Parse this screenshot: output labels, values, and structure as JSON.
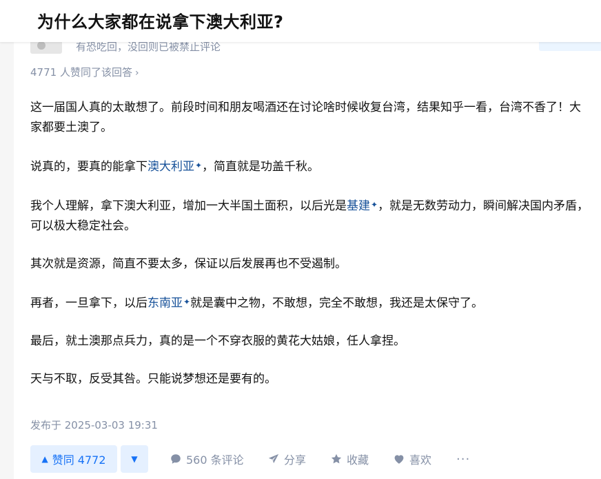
{
  "question": {
    "title": "为什么大家都在说拿下澳大利亚?"
  },
  "author": {
    "notice": "有恐吃回，没回则已被禁止评论"
  },
  "answer": {
    "vote_summary": "4771 人赞同了该回答",
    "paragraphs": [
      {
        "segments": [
          {
            "text": "这一届国人真的太敢想了。前段时间和朋友喝酒还在讨论啥时候收复台湾，结果知乎一看，台湾不香了！大家都要土澳了。"
          }
        ]
      },
      {
        "segments": [
          {
            "text": "说真的，要真的能拿下"
          },
          {
            "text": "澳大利亚",
            "link": true
          },
          {
            "text": "，简直就是功盖千秋。"
          }
        ]
      },
      {
        "segments": [
          {
            "text": "我个人理解，拿下澳大利亚，增加一大半国土面积，以后光是"
          },
          {
            "text": "基建",
            "link": true
          },
          {
            "text": "，就是无数劳动力，瞬间解决国内矛盾，可以极大稳定社会。"
          }
        ]
      },
      {
        "segments": [
          {
            "text": "其次就是资源，简直不要太多，保证以后发展再也不受遏制。"
          }
        ]
      },
      {
        "segments": [
          {
            "text": "再者，一旦拿下，以后"
          },
          {
            "text": "东南亚",
            "link": true
          },
          {
            "text": "就是囊中之物，不敢想，完全不敢想，我还是太保守了。"
          }
        ]
      },
      {
        "segments": [
          {
            "text": "最后，就土澳那点兵力，真的是一个不穿衣服的黄花大姑娘，任人拿捏。"
          }
        ]
      },
      {
        "segments": [
          {
            "text": "天与不取，反受其咎。只能说梦想还是要有的。"
          }
        ]
      }
    ],
    "publish_time": "发布于 2025-03-03 19:31"
  },
  "actions": {
    "vote_up_label": "赞同 4772",
    "comments_label": "560 条评论",
    "share_label": "分享",
    "favorite_label": "收藏",
    "like_label": "喜欢",
    "more_label": "···"
  },
  "icons": {
    "vote_up": "triangle-up-icon",
    "vote_down": "triangle-down-icon",
    "comment": "comment-bubble-icon",
    "share": "paper-plane-icon",
    "favorite": "star-icon",
    "like": "heart-icon",
    "keyword": "sparkle-icon",
    "chevron": "chevron-right-icon"
  },
  "colors": {
    "accent": "#1772f6",
    "link": "#175199",
    "muted": "#8590a6",
    "text": "#121212"
  }
}
